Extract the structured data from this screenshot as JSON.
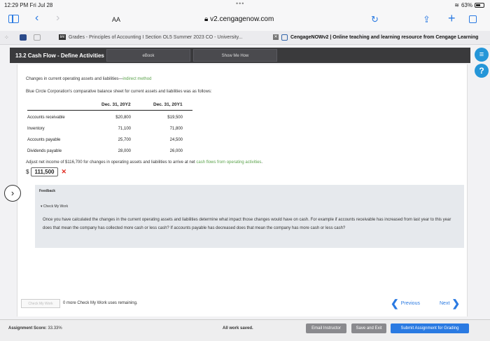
{
  "status_bar": {
    "time": "12:29 PM  Fri Jul 28",
    "dots": "•••",
    "battery": "63%",
    "battery_level": 0.63
  },
  "safari": {
    "text_size": "AA",
    "url": "v2.cengagenow.com"
  },
  "tabs": [
    {
      "favicon": "bhl",
      "title": "Grades - Principles of Accounting I Section OL5 Summer 2023 CO - University..."
    },
    {
      "title": "CengageNOWv2 | Online teaching and learning resource from Cengage Learning"
    }
  ],
  "app": {
    "title": "13.2 Cash Flow - Define Activities",
    "ebook_label": "eBook",
    "show_me_how_label": "Show Me How"
  },
  "question": {
    "heading": "Changes in current operating assets and liabilities—",
    "heading_link": "indirect method",
    "intro": "Blue Circle Corporation's comparative balance sheet for current assets and liabilities was as follows:",
    "columns": [
      "Dec. 31, 20Y2",
      "Dec. 31, 20Y1"
    ],
    "rows": [
      {
        "label": "Accounts receivable",
        "y2": "$20,800",
        "y1": "$19,500"
      },
      {
        "label": "Inventory",
        "y2": "71,100",
        "y1": "71,800"
      },
      {
        "label": "Accounts payable",
        "y2": "25,700",
        "y1": "24,500"
      },
      {
        "label": "Dividends payable",
        "y2": "28,000",
        "y1": "26,000"
      }
    ],
    "adjust_text": "Adjust net income of $116,700 for changes in operating assets and liabilities to arrive at net ",
    "adjust_link": "cash flows from operating activities",
    "adjust_end": ".",
    "currency": "$",
    "answer_value": "111,500",
    "wrong_mark": "✕"
  },
  "feedback": {
    "title": "Feedback",
    "check_my_work": "▾ Check My Work",
    "text": "Once you have calculated the changes in the current operating assets and liabilities determine what impact those changes would have on cash. For example if accounts receivable has increased from last year to this year does that mean the company has collected more cash or less cash? If accounts payable has decreased does that mean the company has more cash or less cash?"
  },
  "bottom": {
    "check_btn": "Check My Work",
    "remaining": "0 more Check My Work uses remaining.",
    "previous": "Previous",
    "next": "Next"
  },
  "footer": {
    "score_label": "Assignment Score:",
    "score_value": "33.33%",
    "saved": "All work saved.",
    "email": "Email Instructor",
    "save_exit": "Save and Exit",
    "submit": "Submit Assignment for Grading"
  },
  "colors": {
    "accent": "#2a7ae2",
    "link_green": "#5aa24a",
    "error_red": "#e0291f",
    "appbar": "#3a3a3c",
    "help_blue": "#2596d8"
  }
}
